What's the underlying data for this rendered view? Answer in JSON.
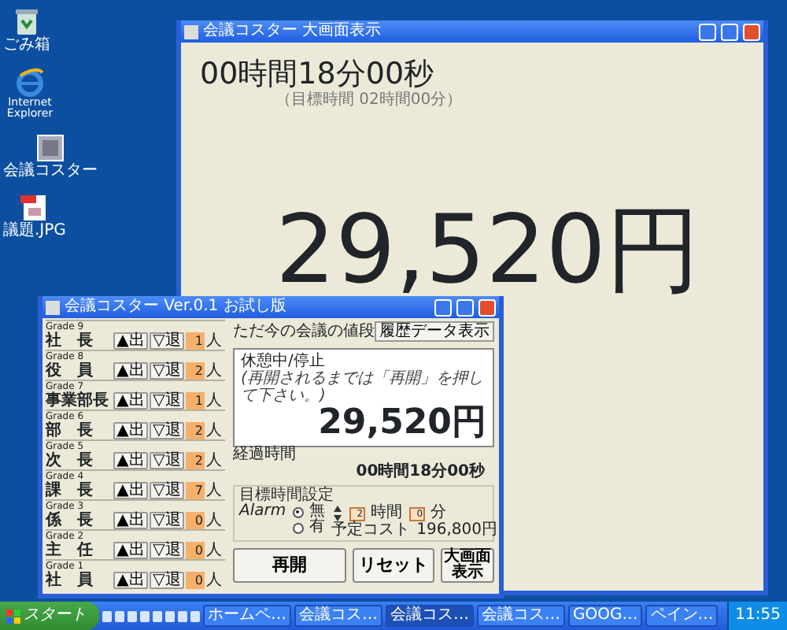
{
  "desktop_icons": [
    {
      "label": "ごみ箱",
      "kind": "trash"
    },
    {
      "label": "Internet Explorer",
      "kind": "ie"
    },
    {
      "label": "会議コスター",
      "kind": "app"
    },
    {
      "label": "議題.JPG",
      "kind": "image"
    }
  ],
  "big_window": {
    "title": "会議コスター 大画面表示",
    "elapsed": "00時間18分00秒",
    "target": "（目標時間 02時間00分）",
    "cost": "29,520円"
  },
  "main_window": {
    "title": "会議コスター Ver.0.1 お試し版",
    "grades": [
      {
        "grade": "Grade 9",
        "name": "社　長",
        "up": "▲出",
        "down": "▽退",
        "count": "1",
        "unit": "人"
      },
      {
        "grade": "Grade 8",
        "name": "役　員",
        "up": "▲出",
        "down": "▽退",
        "count": "2",
        "unit": "人"
      },
      {
        "grade": "Grade 7",
        "name": "事業部長",
        "up": "▲出",
        "down": "▽退",
        "count": "1",
        "unit": "人"
      },
      {
        "grade": "Grade 6",
        "name": "部　長",
        "up": "▲出",
        "down": "▽退",
        "count": "2",
        "unit": "人"
      },
      {
        "grade": "Grade 5",
        "name": "次　長",
        "up": "▲出",
        "down": "▽退",
        "count": "2",
        "unit": "人"
      },
      {
        "grade": "Grade 4",
        "name": "課　長",
        "up": "▲出",
        "down": "▽退",
        "count": "7",
        "unit": "人"
      },
      {
        "grade": "Grade 3",
        "name": "係　長",
        "up": "▲出",
        "down": "▽退",
        "count": "0",
        "unit": "人"
      },
      {
        "grade": "Grade 2",
        "name": "主　任",
        "up": "▲出",
        "down": "▽退",
        "count": "0",
        "unit": "人"
      },
      {
        "grade": "Grade 1",
        "name": "社　員",
        "up": "▲出",
        "down": "▽退",
        "count": "0",
        "unit": "人"
      }
    ],
    "cost_label": "ただ今の会議の値段",
    "history_button": "履歴データ表示",
    "status": "休憩中/停止",
    "note": "(再開されるまでは「再開」を押して下さい。)",
    "cost": "29,520円",
    "elapsed_label": "経過時間",
    "elapsed": "00時間18分00秒",
    "target_group": "目標時間設定",
    "alarm_label": "Alarm",
    "alarm_options": [
      {
        "label": "無",
        "selected": true
      },
      {
        "label": "有",
        "selected": false
      }
    ],
    "hours": "2",
    "hours_unit": "時間",
    "minutes": "0",
    "minutes_unit": "分",
    "planned_label": "予定コスト",
    "planned": "196,800円",
    "buttons": [
      {
        "label": "再開",
        "kind": "wide"
      },
      {
        "label": "リセット",
        "kind": "normal"
      },
      {
        "label": "大画面表示",
        "kind": "small"
      }
    ]
  },
  "taskbar": {
    "start": "スタート",
    "tasks": [
      {
        "label": "ホームペ…",
        "selected": false
      },
      {
        "label": "会議コス…",
        "selected": false
      },
      {
        "label": "会議コス…",
        "selected": true
      },
      {
        "label": "会議コス…",
        "selected": false
      },
      {
        "label": "GOOG…",
        "selected": false
      },
      {
        "label": "ペイン…",
        "selected": false
      }
    ],
    "clock": "11:55"
  }
}
